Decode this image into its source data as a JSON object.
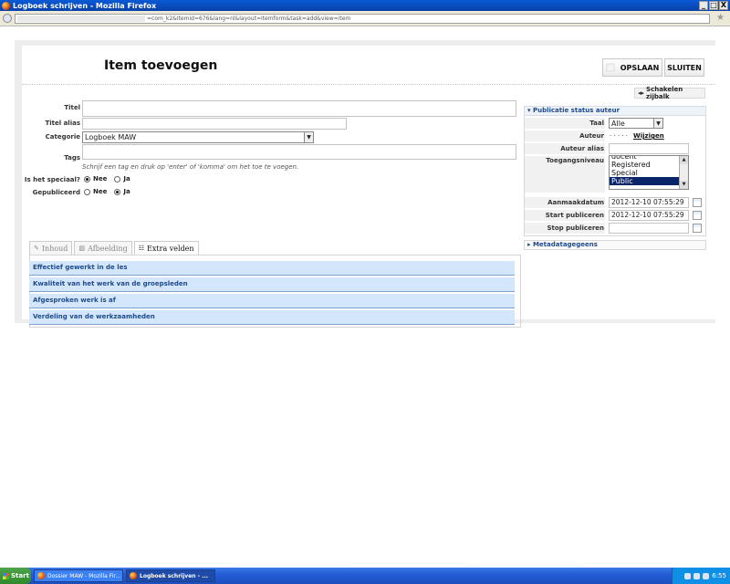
{
  "window": {
    "title": "Logboek schrijven - Mozilla Firefox",
    "address_suffix": "=com_k2&Itemid=676&lang=nl&layout=itemform&task=add&view=item"
  },
  "toolbar": {
    "page_title": "Item toevoegen",
    "save_label": "OPSLAAN",
    "close_label": "SLUITEN",
    "toggle_sidebar_label": "Schakelen zijbalk"
  },
  "form": {
    "title_label": "Titel",
    "title_value": "",
    "alias_label": "Titel alias",
    "alias_value": "",
    "category_label": "Categorie",
    "category_value": "Logboek MAW",
    "tags_label": "Tags",
    "tags_hint": "Schrijf een tag en druk op 'enter' of 'komma' om het toe te voegen.",
    "special_label": "Is het speciaal?",
    "published_label": "Gepubliceerd",
    "no_label": "Nee",
    "yes_label": "Ja"
  },
  "tabs": [
    {
      "label": "Inhoud",
      "active": false
    },
    {
      "label": "Afbeelding",
      "active": false
    },
    {
      "label": "Extra velden",
      "active": true
    }
  ],
  "extra_fields": [
    "Effectief gewerkt in de les",
    "Kwaliteit van het werk van de groepsleden",
    "Afgesproken werk is af",
    "Verdeling van de werkzaamheden"
  ],
  "sidebar": {
    "publication_header": "Publicatie status auteur",
    "language_label": "Taal",
    "language_value": "Alle",
    "author_label": "Auteur",
    "author_value": "· · · · ·",
    "change_label": "Wijzigen",
    "author_alias_label": "Auteur alias",
    "access_label": "Toegangsniveau",
    "access_options": [
      "docent",
      "Registered",
      "Special",
      "Public"
    ],
    "access_selected": "Public",
    "created_label": "Aanmaakdatum",
    "created_value": "2012-12-10 07:55:29",
    "publish_up_label": "Start publiceren",
    "publish_up_value": "2012-12-10 07:55:29",
    "publish_down_label": "Stop publiceren",
    "publish_down_value": "",
    "metadata_header": "Metadatagegeens"
  },
  "taskbar": {
    "start_label": "Start",
    "task1": "Dossier MAW - Mozilla Fir...",
    "task2": "Logboek schrijven - ...",
    "clock": "6:55"
  }
}
